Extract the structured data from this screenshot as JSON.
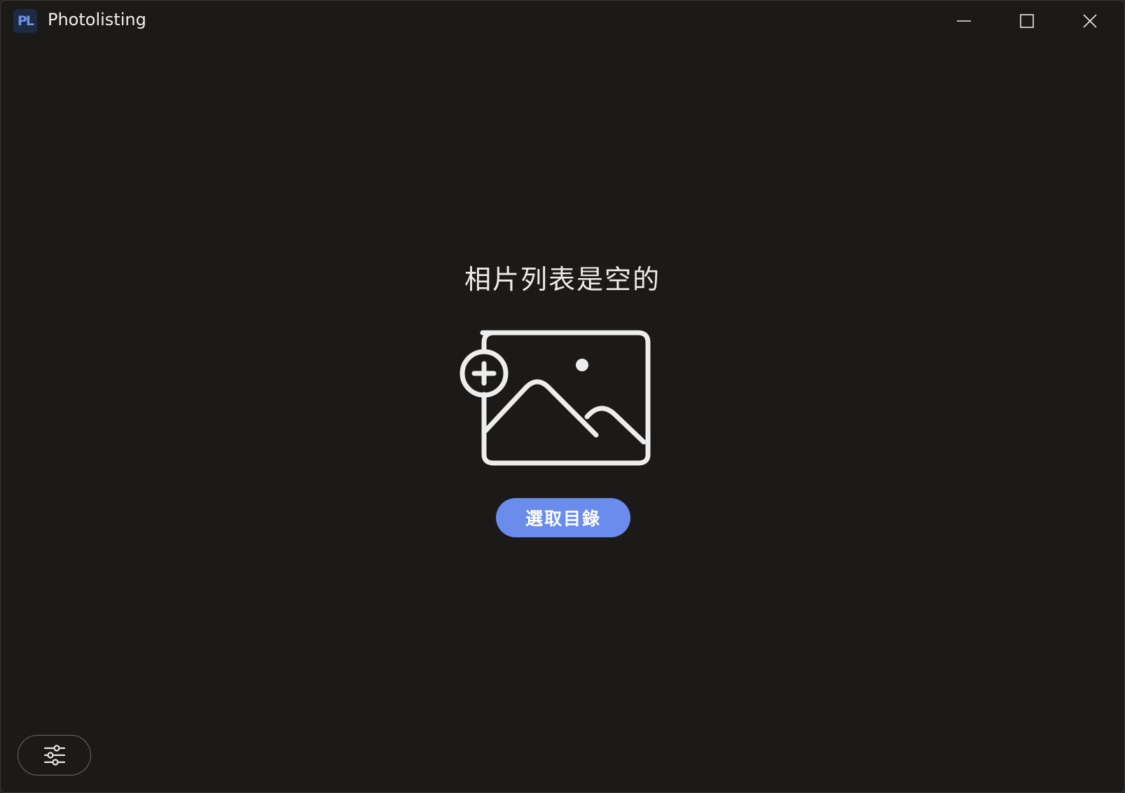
{
  "window": {
    "title": "Photolisting",
    "logo_text": "PL",
    "controls": {
      "minimize_icon": "minimize-icon",
      "maximize_icon": "maximize-icon",
      "close_icon": "close-icon"
    }
  },
  "main": {
    "empty_message": "相片列表是空的",
    "illustration_icon": "add-image-icon",
    "select_directory_label": "選取目錄"
  },
  "footer": {
    "settings_icon": "sliders-icon"
  },
  "colors": {
    "background": "#1b1a19",
    "accent": "#6a8ced",
    "text": "#ececec"
  }
}
